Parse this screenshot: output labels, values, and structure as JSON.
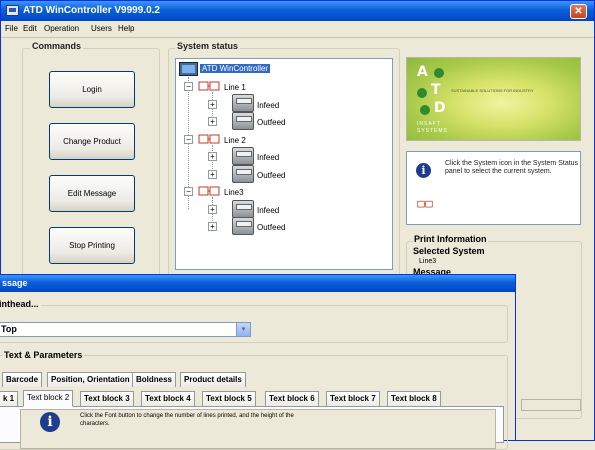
{
  "window": {
    "title": "ATD WinController  V9999.0.2",
    "close_glyph": "✕"
  },
  "menu": [
    {
      "label": "File"
    },
    {
      "label": "Edit"
    },
    {
      "label": "Operation"
    },
    {
      "label": "Users"
    },
    {
      "label": "Help"
    }
  ],
  "commands": {
    "title": "Commands",
    "buttons": [
      {
        "label": "Login"
      },
      {
        "label": "Change Product"
      },
      {
        "label": "Edit Message"
      },
      {
        "label": "Stop Printing"
      }
    ]
  },
  "system_status": {
    "title": "System status",
    "root": "ATD WinController",
    "lines": [
      {
        "label": "Line 1",
        "children": [
          "Infeed",
          "Outfeed"
        ]
      },
      {
        "label": "Line 2",
        "children": [
          "Infeed",
          "Outfeed"
        ]
      },
      {
        "label": "Line3",
        "children": [
          "Infeed",
          "Outfeed"
        ]
      }
    ]
  },
  "logo": {
    "letters": [
      "A",
      "T",
      "D"
    ],
    "tagline": "SUSTAINABLE SOLUTIONS FOR INDUSTRY",
    "sub": "INSAFT SYSTEMS"
  },
  "info": {
    "text": "Click the System icon in the System Status panel to select the current system."
  },
  "print_information": {
    "title": "Print Information",
    "selected_system_label": "Selected System",
    "selected_system_value": "Line3",
    "message_label": "Message"
  },
  "dialog": {
    "title": "ssage",
    "printhead_label": "inthead...",
    "combo_value": "Top",
    "combo_arrow": "▾",
    "section_title": "Text & Parameters",
    "tabs_row1": [
      "Barcode",
      "Position, Orientation",
      "Boldness",
      "Product details"
    ],
    "tabs_row2": [
      "k 1",
      "Text block 2",
      "Text block 3",
      "Text block 4",
      "Text block 5",
      "Text block 6",
      "Text block 7",
      "Text block 8"
    ],
    "active_tab": "Text block 2",
    "info_text": "Click the Font button to change the number of lines printed, and the height of the characters."
  },
  "colors": {
    "titlebar": "#0a5fd8",
    "selection": "#316ac5",
    "face": "#ece9d8"
  }
}
